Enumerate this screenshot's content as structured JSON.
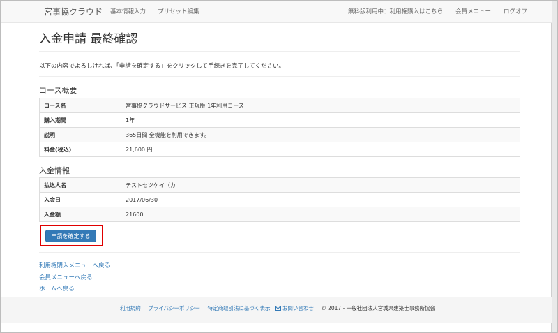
{
  "navbar": {
    "brand": "宮事協クラウド",
    "left_items": [
      "基本情報入力",
      "プリセット編集"
    ],
    "right_items": [
      "無料版利用中：利用権購入はこちら",
      "会員メニュー",
      "ログオフ"
    ]
  },
  "page": {
    "title": "入金申請 最終確認",
    "intro": "以下の内容でよろしければ、「申請を確定する」をクリックして手続きを完了してください。"
  },
  "course": {
    "section_title": "コース概要",
    "rows": [
      {
        "label": "コース名",
        "value": "宮事協クラウドサービス 正規版 1年利用コース"
      },
      {
        "label": "購入期間",
        "value": "1年"
      },
      {
        "label": "説明",
        "value": "365日間 全機能を利用できます。"
      },
      {
        "label": "料金(税込)",
        "value": "21,600 円"
      }
    ]
  },
  "payment": {
    "section_title": "入金情報",
    "rows": [
      {
        "label": "払込人名",
        "value": "テストセツケイ（カ"
      },
      {
        "label": "入金日",
        "value": "2017/06/30"
      },
      {
        "label": "入金額",
        "value": "21600"
      }
    ]
  },
  "actions": {
    "confirm_label": "申請を確定する"
  },
  "links": [
    "利用権購入メニューへ戻る",
    "会員メニューへ戻る",
    "ホームへ戻る"
  ],
  "footer": {
    "links": [
      "利用規約",
      "プライバシーポリシー",
      "特定商取引法に基づく表示",
      "お問い合わせ"
    ],
    "copyright": "© 2017 - 一般社団法人宮城県建築士事務所協会"
  },
  "colors": {
    "link": "#337ab7",
    "button": "#337ab7",
    "highlight": "#e00000"
  }
}
